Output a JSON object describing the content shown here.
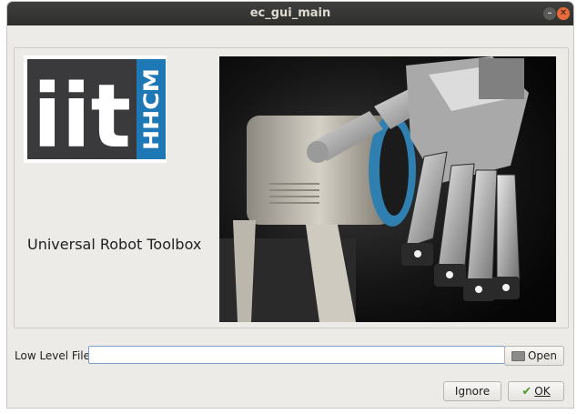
{
  "window": {
    "title": "ec_gui_main",
    "minimize_glyph": "–",
    "close_glyph": "✕"
  },
  "logo": {
    "text_main": "iit",
    "text_side": "HHCM",
    "colors": {
      "dark": "#3a3a3c",
      "blue": "#1f78b6",
      "white": "#ffffff"
    }
  },
  "main": {
    "subtitle": "Universal Robot Toolbox",
    "image": "robot-hand-photo"
  },
  "file_row": {
    "label": "Low Level File",
    "value": "",
    "placeholder": "",
    "open_button_label": "Open",
    "open_icon": "folder-icon"
  },
  "footer": {
    "ignore_label": "Ignore",
    "ok_label": "OK",
    "ok_icon": "checkmark-icon"
  },
  "colors": {
    "titlebar": "#353534",
    "window_bg": "#edebe8",
    "input_border": "#7c9fc8",
    "close_button": "#e66a3a"
  }
}
